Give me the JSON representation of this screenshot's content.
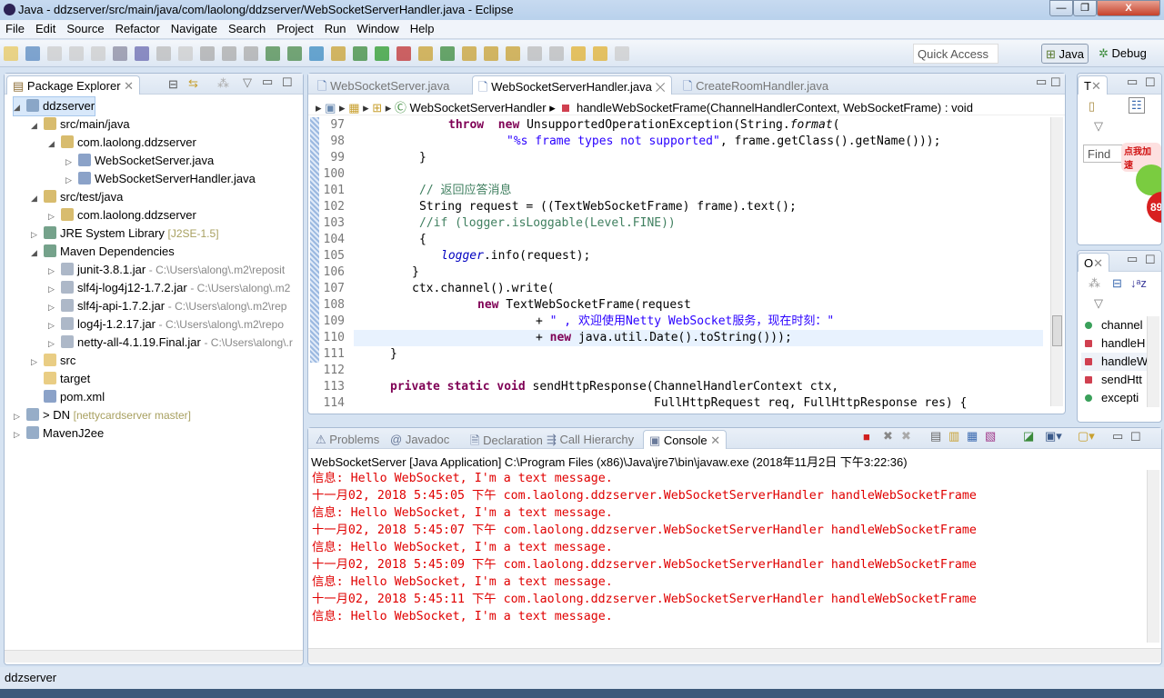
{
  "window": {
    "title": "Java - ddzserver/src/main/java/com/laolong/ddzserver/WebSocketServerHandler.java - Eclipse",
    "minimize": "—",
    "restore": "❐",
    "close": "X"
  },
  "menu": [
    "File",
    "Edit",
    "Source",
    "Refactor",
    "Navigate",
    "Search",
    "Project",
    "Run",
    "Window",
    "Help"
  ],
  "toolbar": {
    "quick_access_placeholder": "Quick Access",
    "perspectives": [
      "Java",
      "Debug"
    ]
  },
  "package_explorer": {
    "title": "Package Explorer",
    "nodes": [
      {
        "label": "ddzserver",
        "extra": ""
      },
      {
        "label": "src/main/java",
        "extra": ""
      },
      {
        "label": "com.laolong.ddzserver",
        "extra": ""
      },
      {
        "label": "WebSocketServer.java",
        "extra": ""
      },
      {
        "label": "WebSocketServerHandler.java",
        "extra": ""
      },
      {
        "label": "src/test/java",
        "extra": ""
      },
      {
        "label": "com.laolong.ddzserver",
        "extra": ""
      },
      {
        "label": "JRE System Library",
        "extra": "[J2SE-1.5]"
      },
      {
        "label": "Maven Dependencies",
        "extra": ""
      },
      {
        "label": "junit-3.8.1.jar",
        "extra": "- C:\\Users\\along\\.m2\\reposit"
      },
      {
        "label": "slf4j-log4j12-1.7.2.jar",
        "extra": "- C:\\Users\\along\\.m2"
      },
      {
        "label": "slf4j-api-1.7.2.jar",
        "extra": "- C:\\Users\\along\\.m2\\rep"
      },
      {
        "label": "log4j-1.2.17.jar",
        "extra": "- C:\\Users\\along\\.m2\\repo"
      },
      {
        "label": "netty-all-4.1.19.Final.jar",
        "extra": "- C:\\Users\\along\\.r"
      },
      {
        "label": "src",
        "extra": ""
      },
      {
        "label": "target",
        "extra": ""
      },
      {
        "label": "pom.xml",
        "extra": ""
      },
      {
        "label": "> DN",
        "extra": "[nettycardserver master]"
      },
      {
        "label": "MavenJ2ee",
        "extra": ""
      }
    ]
  },
  "editor": {
    "tabs": [
      "WebSocketServer.java",
      "WebSocketServerHandler.java",
      "CreateRoomHandler.java"
    ],
    "active_tab": 1,
    "breadcrumb": {
      "class": "WebSocketServerHandler",
      "method": "handleWebSocketFrame(ChannelHandlerContext, WebSocketFrame) : void"
    },
    "lines": [
      {
        "n": "97",
        "seg": [
          [
            "kw",
            "throw"
          ],
          [
            "",
            "  "
          ],
          [
            "kw",
            "new"
          ],
          [
            "",
            " UnsupportedOperationException(String."
          ],
          [
            "it",
            "format"
          ],
          [
            "",
            "("
          ]
        ]
      },
      {
        "n": "98",
        "seg": [
          [
            "str",
            "\"%s frame types not supported\""
          ],
          [
            "",
            ", frame.getClass().getName()));"
          ]
        ]
      },
      {
        "n": "99",
        "seg": [
          [
            "",
            "}"
          ]
        ]
      },
      {
        "n": "100",
        "seg": []
      },
      {
        "n": "101",
        "seg": [
          [
            "cm",
            "// 返回应答消息"
          ]
        ]
      },
      {
        "n": "102",
        "seg": [
          [
            "",
            "String request = ((TextWebSocketFrame) frame).text();"
          ]
        ]
      },
      {
        "n": "103",
        "seg": [
          [
            "cm",
            "//if (logger.isLoggable(Level.FINE))"
          ]
        ]
      },
      {
        "n": "104",
        "seg": [
          [
            "",
            "{"
          ]
        ]
      },
      {
        "n": "105",
        "seg": [
          [
            "fld it",
            "logger"
          ],
          [
            "",
            ".info(request);"
          ]
        ]
      },
      {
        "n": "106",
        "seg": [
          [
            "",
            "}"
          ]
        ]
      },
      {
        "n": "107",
        "seg": [
          [
            "",
            "ctx.channel().write("
          ]
        ]
      },
      {
        "n": "108",
        "seg": [
          [
            "kw",
            "new"
          ],
          [
            "",
            " TextWebSocketFrame(request"
          ]
        ]
      },
      {
        "n": "109",
        "seg": [
          [
            "",
            "+ "
          ],
          [
            "str",
            "\" , 欢迎使用Netty WebSocket服务，现在时刻：\""
          ]
        ]
      },
      {
        "n": "110",
        "seg": [
          [
            "",
            "+ "
          ],
          [
            "kw",
            "new"
          ],
          [
            "",
            " java.util.Date().toString()));"
          ]
        ]
      },
      {
        "n": "111",
        "seg": [
          [
            "",
            "}"
          ]
        ]
      },
      {
        "n": "112",
        "seg": []
      },
      {
        "n": "113",
        "seg": [
          [
            "kw",
            "private static void"
          ],
          [
            "",
            " sendHttpResponse(ChannelHandlerContext ctx,"
          ]
        ]
      },
      {
        "n": "114",
        "seg": [
          [
            "",
            "FullHttpRequest req, FullHttpResponse res) {"
          ]
        ]
      }
    ]
  },
  "task_list": {
    "title": "T",
    "find_placeholder": "Find",
    "ad_text": "点我加速",
    "ad_badge": "89"
  },
  "outline": {
    "title": "O",
    "items": [
      "channel",
      "handleH",
      "handleW",
      "sendHtt",
      "excepti"
    ]
  },
  "console": {
    "tabs": [
      "Problems",
      "Javadoc",
      "Declaration",
      "Call Hierarchy",
      "Console"
    ],
    "active_tab": 4,
    "process": "WebSocketServer [Java Application] C:\\Program Files (x86)\\Java\\jre7\\bin\\javaw.exe (2018年11月2日 下午3:22:36)",
    "output": [
      "信息: Hello WebSocket, I'm a text message.",
      "十一月02, 2018 5:45:05 下午 com.laolong.ddzserver.WebSocketServerHandler handleWebSocketFrame",
      "信息: Hello WebSocket, I'm a text message.",
      "十一月02, 2018 5:45:07 下午 com.laolong.ddzserver.WebSocketServerHandler handleWebSocketFrame",
      "信息: Hello WebSocket, I'm a text message.",
      "十一月02, 2018 5:45:09 下午 com.laolong.ddzserver.WebSocketServerHandler handleWebSocketFrame",
      "信息: Hello WebSocket, I'm a text message.",
      "十一月02, 2018 5:45:11 下午 com.laolong.ddzserver.WebSocketServerHandler handleWebSocketFrame",
      "信息: Hello WebSocket, I'm a text message."
    ],
    "output_color": "#e00000"
  },
  "status": {
    "text": "ddzserver"
  }
}
